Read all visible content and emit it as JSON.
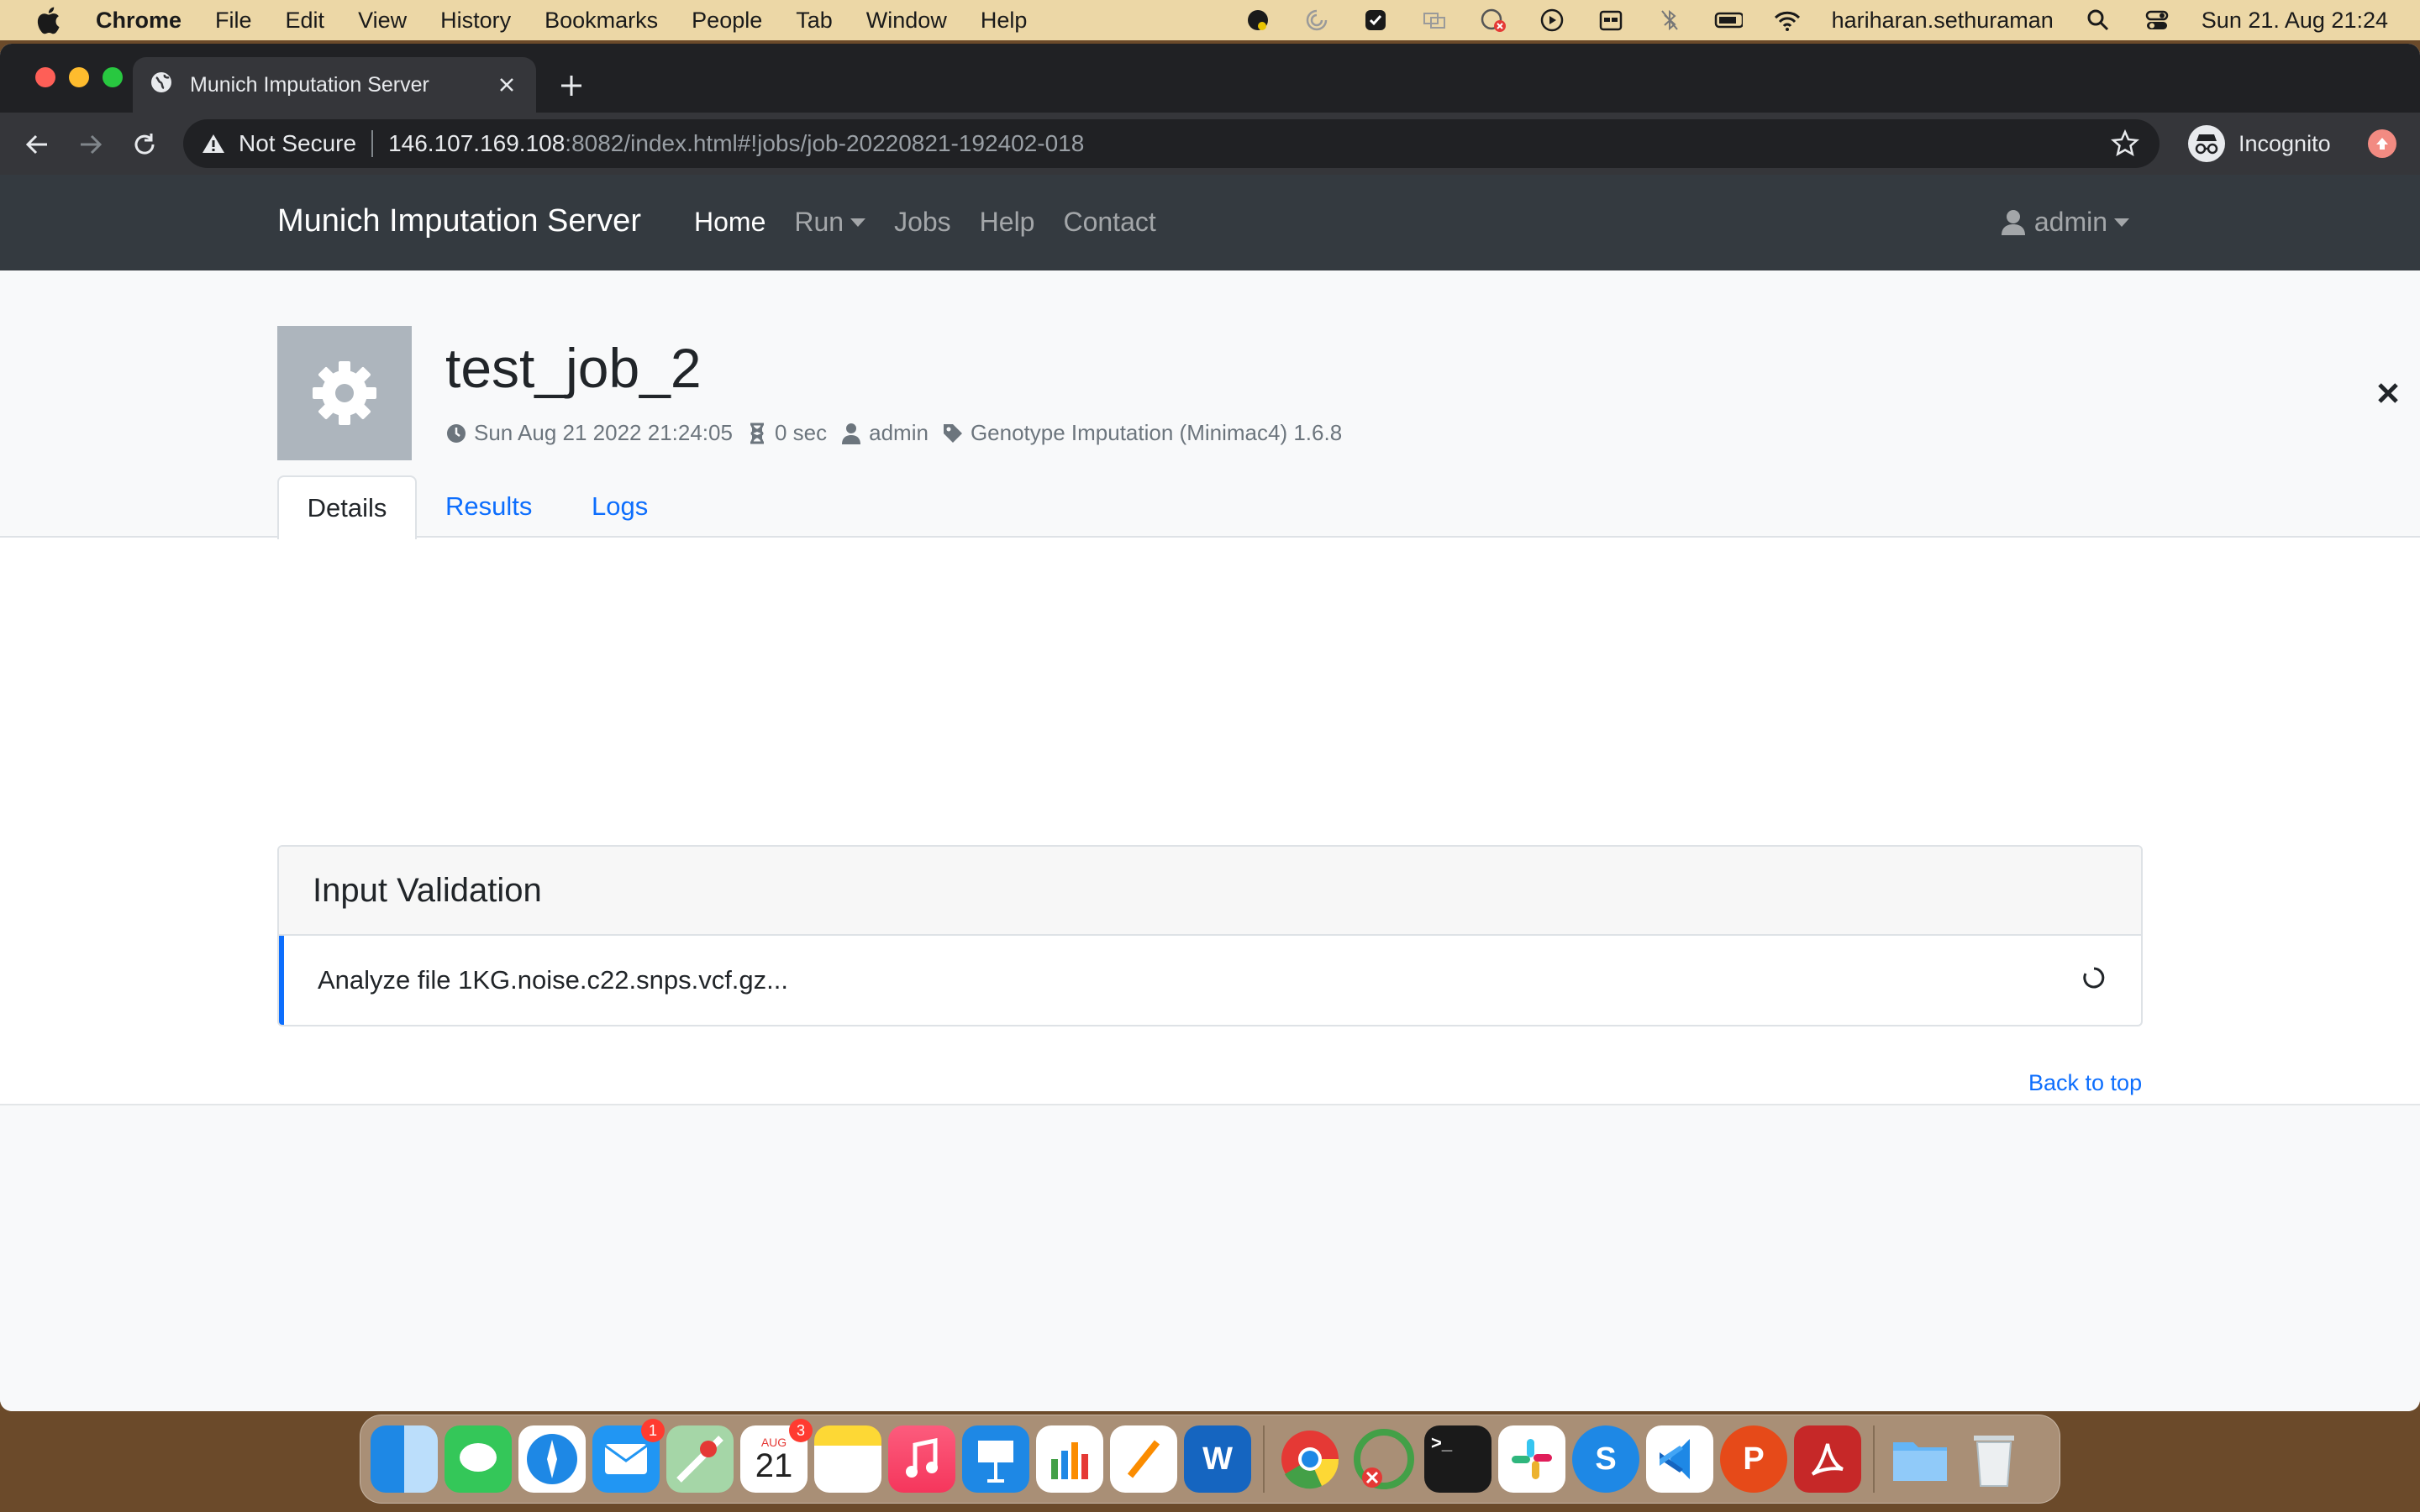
{
  "menubar": {
    "app": "Chrome",
    "items": [
      "File",
      "Edit",
      "View",
      "History",
      "Bookmarks",
      "People",
      "Tab",
      "Window",
      "Help"
    ],
    "username": "hariharan.sethuraman",
    "datetime": "Sun 21. Aug  21:24"
  },
  "browser": {
    "tab_title": "Munich Imputation Server",
    "not_secure": "Not Secure",
    "url_host": "146.107.169.108",
    "url_path": ":8082/index.html#!jobs/job-20220821-192402-018",
    "incognito_label": "Incognito"
  },
  "navbar": {
    "brand": "Munich Imputation Server",
    "links": [
      "Home",
      "Run",
      "Jobs",
      "Help",
      "Contact"
    ],
    "user": "admin"
  },
  "job": {
    "title": "test_job_2",
    "submitted": "Sun Aug 21 2022 21:24:05",
    "duration": "0 sec",
    "owner": "admin",
    "application": "Genotype Imputation (Minimac4) 1.6.8"
  },
  "tabs": [
    "Details",
    "Results",
    "Logs"
  ],
  "step": {
    "name": "Input Validation",
    "message": "Analyze file 1KG.noise.c22.snps.vcf.gz..."
  },
  "footer": {
    "back_to_top": "Back to top"
  },
  "dock": {
    "mail_badge": "1",
    "calendar_month": "AUG",
    "calendar_day": "21",
    "calendar_badge": "3"
  },
  "colors": {
    "navbar": "#343a40",
    "link": "#0d6efd",
    "active_step": "#0d6efd"
  }
}
